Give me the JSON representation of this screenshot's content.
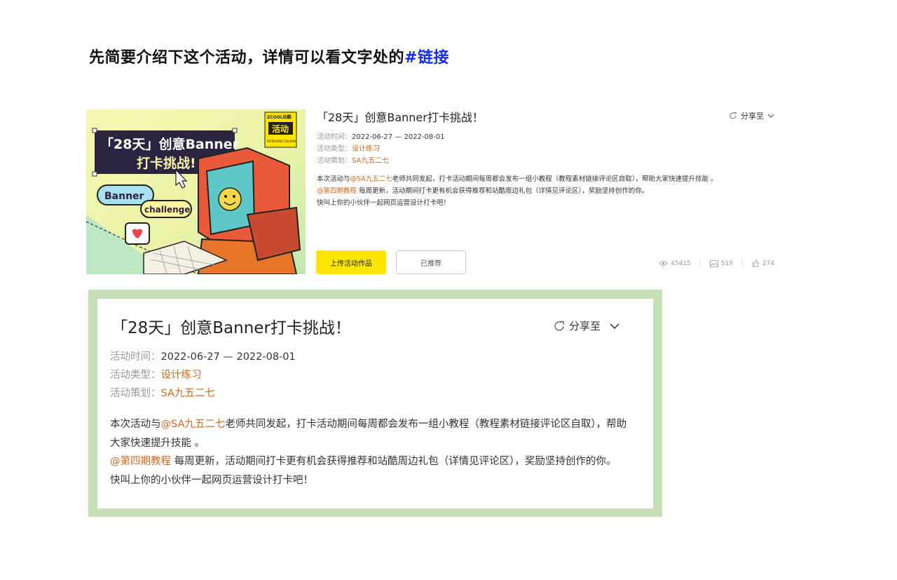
{
  "heading": {
    "text": "先简要介绍下这个活动，详情可以看文字处的",
    "link": "#链接"
  },
  "card": {
    "title": "「28天」创意Banner打卡挑战！",
    "share_label": "分享至",
    "meta": [
      {
        "label": "活动时间：",
        "value": "2022-06-27 — 2022-08-01"
      },
      {
        "label": "活动类型：",
        "value": "设计练习"
      },
      {
        "label": "活动策划：",
        "value": "SA九五二七"
      }
    ],
    "desc": {
      "p1_pre": "本次活动与",
      "p1_mention": "@SA九五二七",
      "p1_post": "老师共同发起，打卡活动期间每周都会发布一组小教程（教程素材链接评论区自取），帮助大家快速提升技能 。",
      "p2_link": "@第四期教程",
      "p2_post": " 每周更新，活动期间打卡更有机会获得推荐和站酷周边礼包（详情见评论区），奖励坚持创作的你。",
      "p3": "快叫上你的小伙伴一起网页运营设计打卡吧！"
    },
    "upload_button": "上传活动作品",
    "recommended_button": "已推荐",
    "stats": {
      "views": "45415",
      "works": "519",
      "likes": "274"
    }
  },
  "banner": {
    "logo_top": "ZCOOL站酷",
    "logo_main": "活动",
    "logo_sub": "INTERVIEW COLUMN",
    "line1": "「28天」创意Banner",
    "line2": "打卡挑战!",
    "bubble1": "Banner",
    "bubble2": "challenge"
  },
  "colors": {
    "link": "#1a2ce8",
    "accent": "#d2691e",
    "upload": "#ffe600",
    "zoom_border": "#c6e0b5"
  }
}
